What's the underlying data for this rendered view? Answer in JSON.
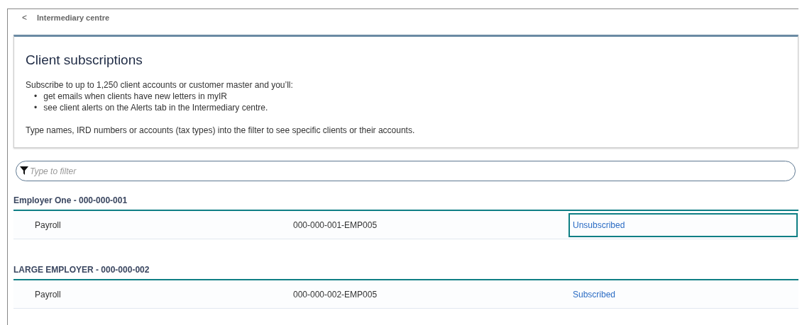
{
  "breadcrumb": {
    "back_icon": "<",
    "label": "Intermediary centre"
  },
  "intro": {
    "title": "Client subscriptions",
    "lead": "Subscribe to up to 1,250 client accounts or customer master and you’ll:",
    "bullets": [
      {
        "marker": "•",
        "text": "get emails when clients have new letters in myIR"
      },
      {
        "marker": "•",
        "text": "see client alerts on the Alerts tab in the Intermediary centre."
      }
    ],
    "note": "Type names, IRD numbers or accounts (tax types) into the filter to see specific clients or their accounts."
  },
  "filter": {
    "placeholder": "Type to filter"
  },
  "groups": [
    {
      "heading": "Employer One - 000-000-001",
      "rows": [
        {
          "account": "Payroll",
          "number": "000-000-001-EMP005",
          "status": "Unsubscribed",
          "focused": true
        }
      ]
    },
    {
      "heading": "LARGE EMPLOYER - 000-000-002",
      "rows": [
        {
          "account": "Payroll",
          "number": "000-000-002-EMP005",
          "status": "Subscribed",
          "focused": false
        }
      ]
    }
  ]
}
